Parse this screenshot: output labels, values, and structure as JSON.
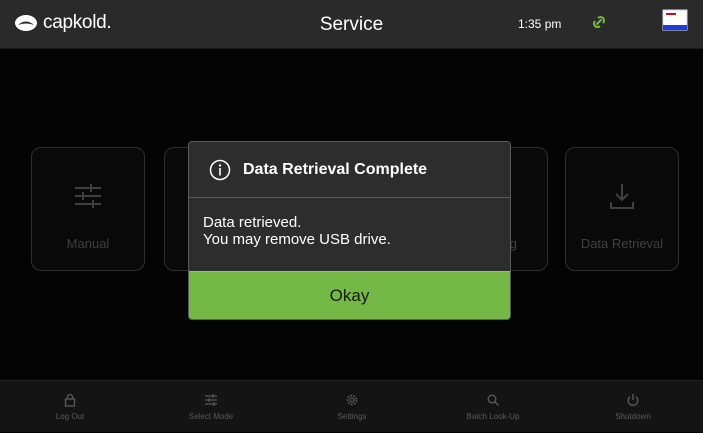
{
  "header": {
    "logo_text": "capkold.",
    "title": "Service",
    "time": "1:35 pm",
    "icons": [
      "logo-icon",
      "link-icon",
      "window-icon"
    ],
    "accent_color": "#74b946"
  },
  "tiles": [
    {
      "label": "Manual",
      "icon": "sliders-icon"
    },
    {
      "label": "",
      "icon": ""
    },
    {
      "label": "g",
      "icon": ""
    },
    {
      "label": "Data Retrieval",
      "icon": "download-icon"
    }
  ],
  "dialog": {
    "title": "Data Retrieval Complete",
    "message_line1": "Data retrieved.",
    "message_line2": "You may remove USB drive.",
    "button_label": "Okay",
    "icon": "info-icon"
  },
  "bottom_nav": [
    {
      "label": "Log Out",
      "icon": "lock-icon"
    },
    {
      "label": "Select Mode",
      "icon": "sliders-icon"
    },
    {
      "label": "Settings",
      "icon": "gear-icon"
    },
    {
      "label": "Batch Look-Up",
      "icon": "search-icon"
    },
    {
      "label": "Shutdown",
      "icon": "power-icon"
    }
  ]
}
